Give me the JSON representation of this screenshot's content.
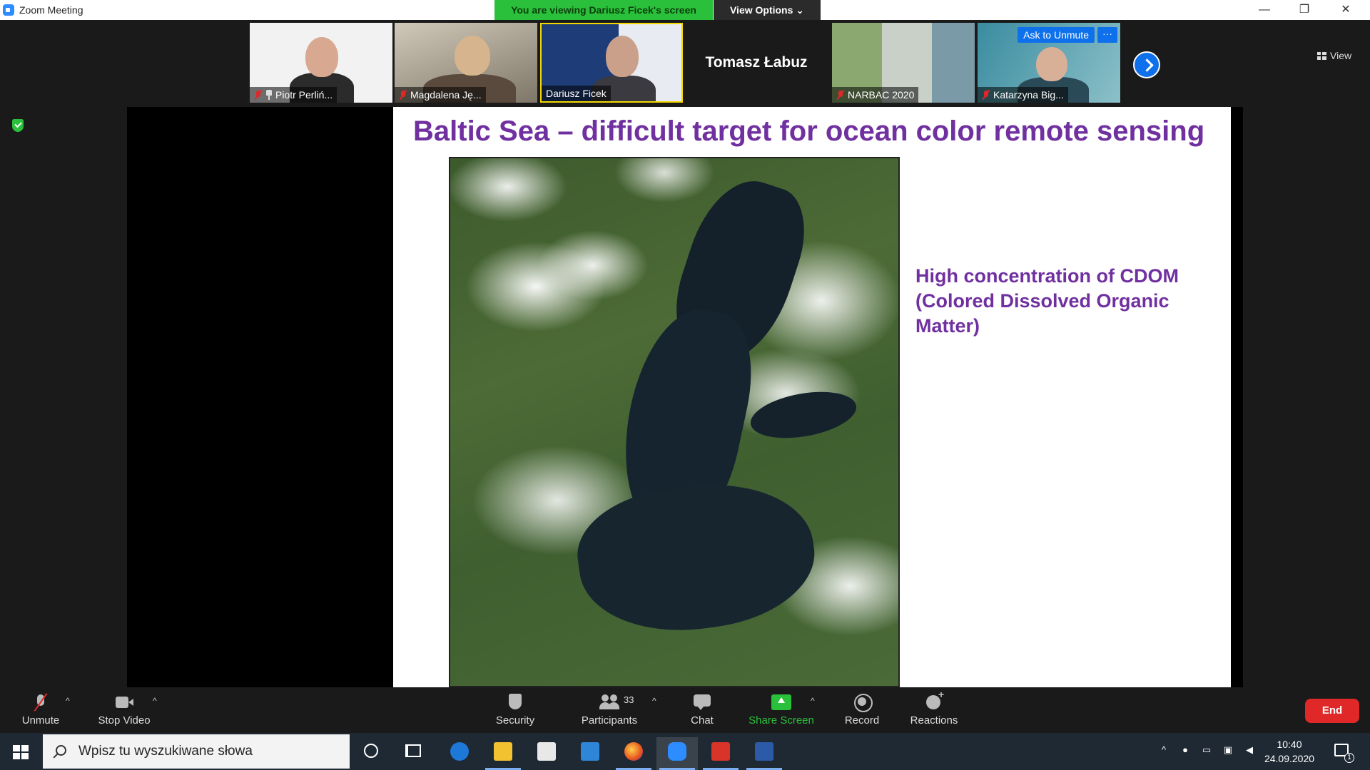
{
  "window": {
    "title": "Zoom Meeting",
    "viewing_banner": "You are viewing Dariusz Ficek's screen",
    "view_options": "View Options ⌄"
  },
  "participants_strip": {
    "tiles": [
      {
        "name": "Piotr Perliń...",
        "muted": true,
        "pinned": true
      },
      {
        "name": "Magdalena Ję...",
        "muted": true
      },
      {
        "name": "Dariusz Ficek",
        "muted": false
      },
      {
        "name": "Tomasz Łabuz",
        "video": false
      },
      {
        "name": "NARBAC 2020",
        "muted": true
      },
      {
        "name": "Katarzyna Big...",
        "muted": true
      }
    ],
    "ask_to_unmute": "Ask to Unmute",
    "more": "···",
    "view_label": "View"
  },
  "slide": {
    "title": "Baltic Sea – difficult target for ocean color remote sensing",
    "text": "High concentration of CDOM (Colored Dissolved Organic Matter)"
  },
  "toolbar": {
    "unmute": "Unmute",
    "stop_video": "Stop Video",
    "security": "Security",
    "participants": "Participants",
    "participants_count": "33",
    "chat": "Chat",
    "share_screen": "Share Screen",
    "record": "Record",
    "reactions": "Reactions",
    "end": "End",
    "caret": "^"
  },
  "taskbar": {
    "search_placeholder": "Wpisz tu wyszukiwane słowa",
    "time": "10:40",
    "date": "24.09.2020",
    "notification_count": "1"
  },
  "colors": {
    "accent_blue": "#0e71eb",
    "banner_green": "#2ac03b",
    "end_red": "#e02828",
    "slide_purple": "#7030a0"
  }
}
